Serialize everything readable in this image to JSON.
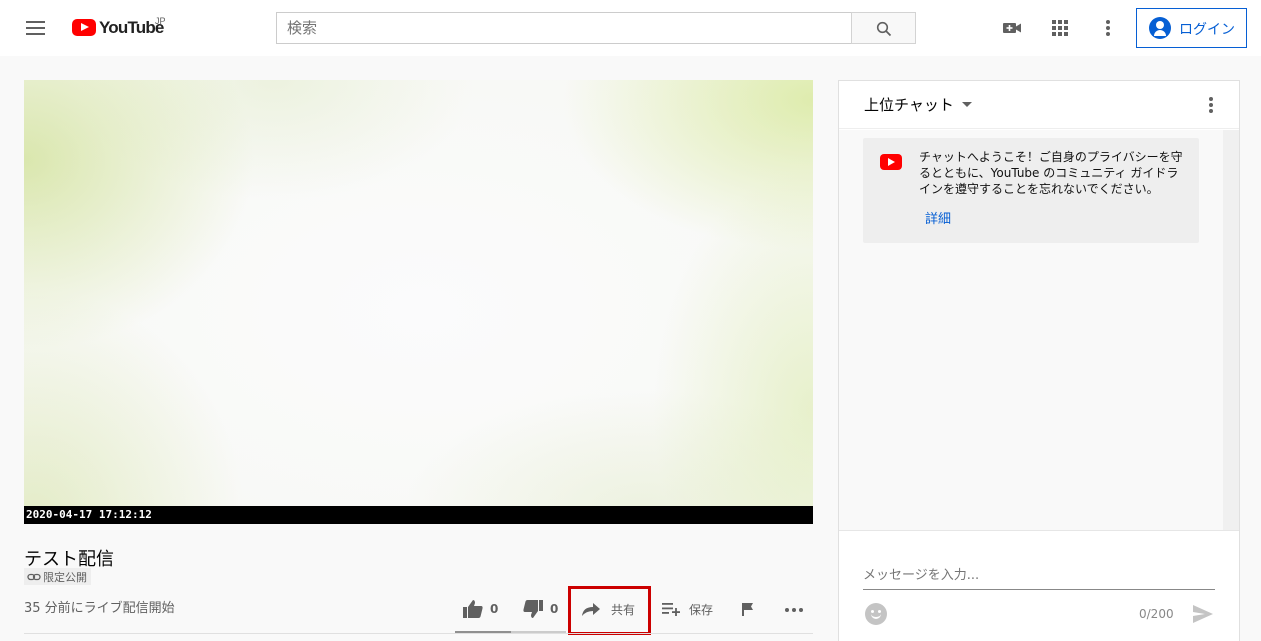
{
  "header": {
    "logo_text": "YouTube",
    "logo_region": "JP",
    "search_placeholder": "検索",
    "login_label": "ログイン"
  },
  "video": {
    "timestamp_overlay": "2020-04-17  17:12:12",
    "title": "テスト配信",
    "privacy_label": "限定公開",
    "live_info": "35 分前にライブ配信開始",
    "likes": "0",
    "dislikes": "0",
    "share_label": "共有",
    "save_label": "保存",
    "like_ratio": 0.5
  },
  "chat": {
    "mode_label": "上位チャット",
    "welcome_message": "チャットへようこそ！ご自身のプライバシーを守るとともに、YouTube のコミュニティ ガイドラインを遵守することを忘れないでください。",
    "learn_more": "詳細",
    "input_placeholder": "メッセージを入力...",
    "char_count": "0/200"
  },
  "colors": {
    "brand_red": "#ff0000",
    "link_blue": "#065fd4",
    "highlight_red": "#cc0000"
  }
}
